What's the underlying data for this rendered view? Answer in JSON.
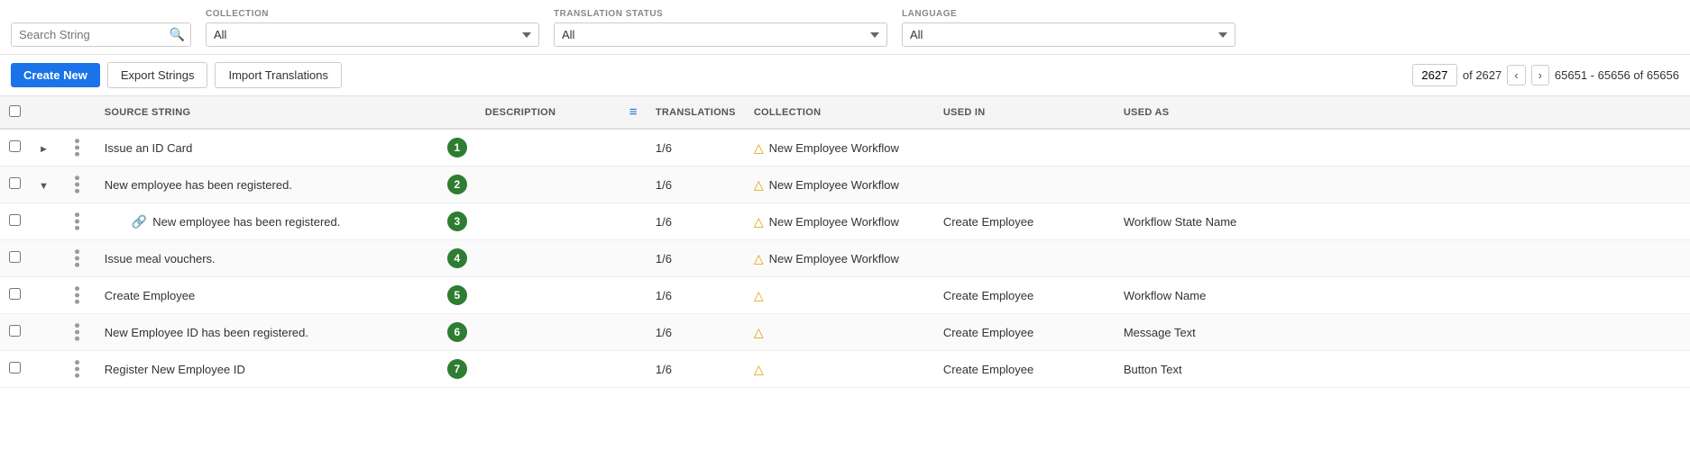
{
  "filters": {
    "search_placeholder": "Search String",
    "collection_label": "COLLECTION",
    "collection_value": "All",
    "translation_status_label": "TRANSLATION STATUS",
    "translation_status_value": "All",
    "language_label": "LANGUAGE",
    "language_value": "All"
  },
  "actions": {
    "create_new": "Create New",
    "export_strings": "Export Strings",
    "import_translations": "Import Translations"
  },
  "pagination": {
    "current_page": "2627",
    "of_label": "of 2627",
    "range": "65651 - 65656 of 65656"
  },
  "table": {
    "columns": {
      "source_string": "SOURCE STRING",
      "description": "DESCRIPTION",
      "translations": "TRANSLATIONS",
      "collection": "COLLECTION",
      "used_in": "USED IN",
      "used_as": "USED AS"
    },
    "rows": [
      {
        "id": 1,
        "menu": "•••",
        "expand_type": "arrow-right",
        "source_string": "Issue an ID Card",
        "badge": "1",
        "description": "",
        "translations": "1/6",
        "collection_icon": "warn",
        "collection": "New Employee Workflow",
        "used_in": "",
        "used_as": "",
        "link": false,
        "indent": false
      },
      {
        "id": 2,
        "menu": "•••",
        "expand_type": "arrow-down",
        "source_string": "New employee has been registered.",
        "badge": "2",
        "description": "",
        "translations": "1/6",
        "collection_icon": "warn",
        "collection": "New Employee Workflow",
        "used_in": "",
        "used_as": "",
        "link": false,
        "indent": false
      },
      {
        "id": 3,
        "menu": "•••",
        "expand_type": "none",
        "source_string": "New employee has been registered.",
        "badge": "3",
        "description": "",
        "translations": "1/6",
        "collection_icon": "warn",
        "collection": "New Employee Workflow",
        "used_in": "Create Employee",
        "used_as": "Workflow State Name",
        "link": true,
        "indent": true
      },
      {
        "id": 4,
        "menu": "•••",
        "expand_type": "none",
        "source_string": "Issue meal vouchers.",
        "badge": "4",
        "description": "",
        "translations": "1/6",
        "collection_icon": "warn",
        "collection": "New Employee Workflow",
        "used_in": "",
        "used_as": "",
        "link": false,
        "indent": false
      },
      {
        "id": 5,
        "menu": "•••",
        "expand_type": "none",
        "source_string": "Create Employee",
        "badge": "5",
        "description": "",
        "translations": "1/6",
        "collection_icon": "warn-empty",
        "collection": "",
        "used_in": "Create Employee",
        "used_as": "Workflow Name",
        "link": false,
        "indent": false
      },
      {
        "id": 6,
        "menu": "•••",
        "expand_type": "none",
        "source_string": "New Employee ID has been registered.",
        "badge": "6",
        "description": "",
        "translations": "1/6",
        "collection_icon": "warn-empty",
        "collection": "",
        "used_in": "Create Employee",
        "used_as": "Message Text",
        "link": false,
        "indent": false
      },
      {
        "id": 7,
        "menu": "•••",
        "expand_type": "none",
        "source_string": "Register New Employee ID",
        "badge": "7",
        "description": "",
        "translations": "1/6",
        "collection_icon": "warn-empty",
        "collection": "",
        "used_in": "Create Employee",
        "used_as": "Button Text",
        "link": false,
        "indent": false
      }
    ]
  }
}
